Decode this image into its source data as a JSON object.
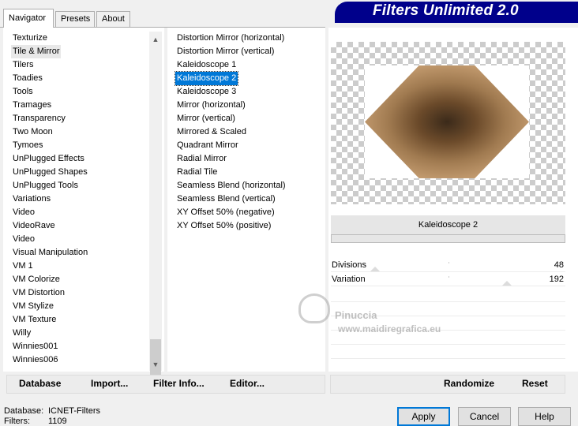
{
  "tabs": [
    "Navigator",
    "Presets",
    "About"
  ],
  "banner_title": "Filters Unlimited 2.0",
  "categories": [
    "Texturize",
    "Tile & Mirror",
    "Tilers",
    "Toadies",
    "Tools",
    "Tramages",
    "Transparency",
    "Two Moon",
    "Tymoes",
    "UnPlugged Effects",
    "UnPlugged Shapes",
    "UnPlugged Tools",
    "Variations",
    "Video",
    "VideoRave",
    "Video",
    "Visual Manipulation",
    "VM 1",
    "VM Colorize",
    "VM Distortion",
    "VM Stylize",
    "VM Texture",
    "Willy",
    "Winnies001",
    "Winnies006"
  ],
  "selected_category": "Tile & Mirror",
  "filters": [
    "Distortion Mirror (horizontal)",
    "Distortion Mirror (vertical)",
    "Kaleidoscope 1",
    "Kaleidoscope 2",
    "Kaleidoscope 3",
    "Mirror (horizontal)",
    "Mirror (vertical)",
    "Mirrored & Scaled",
    "Quadrant Mirror",
    "Radial Mirror",
    "Radial Tile",
    "Seamless Blend (horizontal)",
    "Seamless Blend (vertical)",
    "XY Offset 50% (negative)",
    "XY Offset 50% (positive)"
  ],
  "selected_filter": "Kaleidoscope 2",
  "preview_filter_name": "Kaleidoscope 2",
  "params": [
    {
      "label": "Divisions",
      "value": "48",
      "level": 0.19
    },
    {
      "label": "Variation",
      "value": "192",
      "level": 0.75
    }
  ],
  "buttons": {
    "database": "Database",
    "import": "Import...",
    "filter_info": "Filter Info...",
    "editor": "Editor...",
    "randomize": "Randomize",
    "reset": "Reset",
    "apply": "Apply",
    "cancel": "Cancel",
    "help": "Help"
  },
  "status": {
    "database_label": "Database:",
    "database_value": "ICNET-Filters",
    "filters_label": "Filters:",
    "filters_value": "1109"
  },
  "watermark": {
    "line1": "Pinuccia",
    "line2": "www.maidiregrafica.eu"
  },
  "colors": {
    "selection": "#0078d7",
    "banner": "#00008b"
  }
}
